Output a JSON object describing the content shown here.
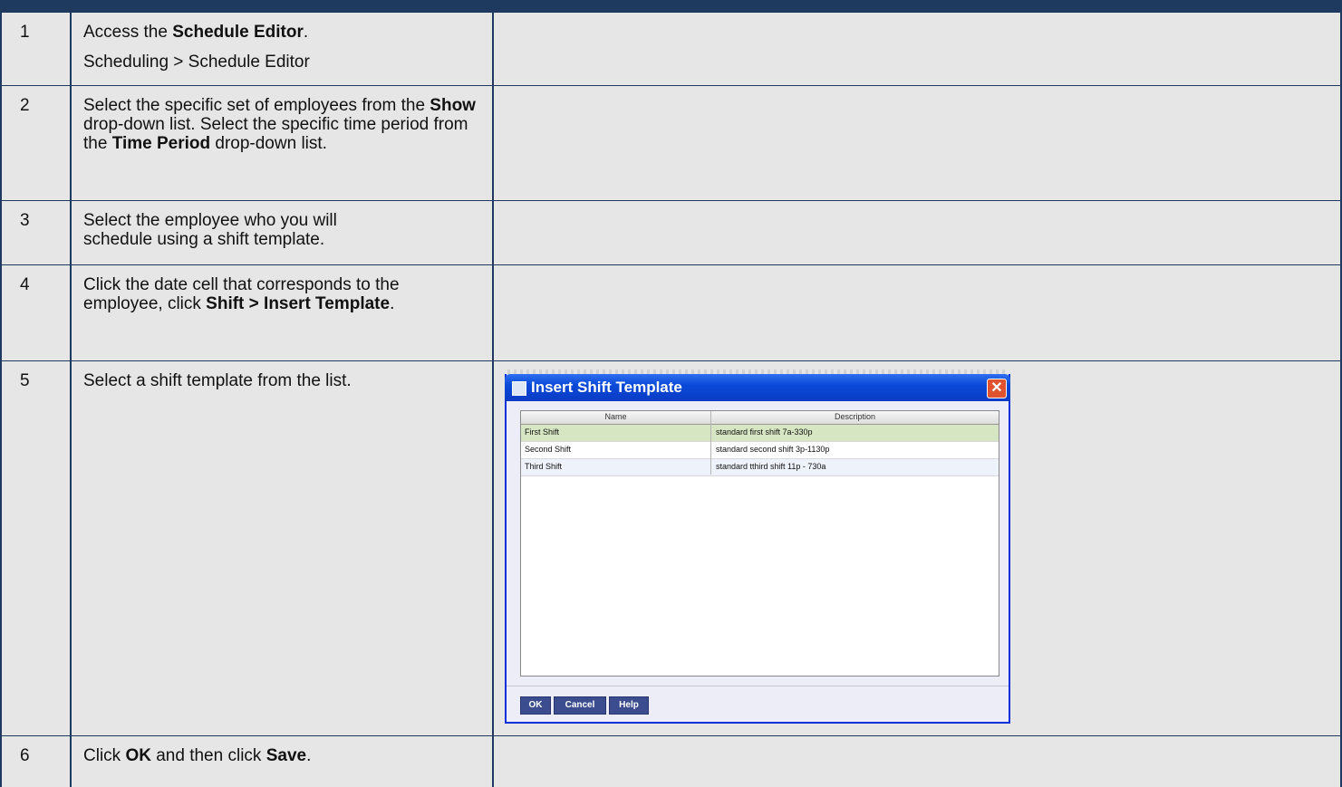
{
  "steps": [
    {
      "num": "1",
      "parts": [
        {
          "t": "Access the "
        },
        {
          "t": "Schedule Editor",
          "b": true
        },
        {
          "t": "."
        }
      ],
      "sub": "Scheduling > Schedule Editor"
    },
    {
      "num": "2",
      "parts": [
        {
          "t": "Select the specific set of employees from the "
        },
        {
          "t": "Show",
          "b": true
        },
        {
          "t": " drop-down list. Select the specific time period from the "
        },
        {
          "t": "Time Period",
          "b": true
        },
        {
          "t": " drop-down list."
        }
      ]
    },
    {
      "num": "3",
      "parts": [
        {
          "t": "Select the employee who you will schedule using a shift template."
        }
      ]
    },
    {
      "num": "4",
      "parts": [
        {
          "t": "Click the date cell that corresponds to the employee, click "
        },
        {
          "t": "Shift > Insert Template",
          "b": true
        },
        {
          "t": "."
        }
      ]
    },
    {
      "num": "5",
      "parts": [
        {
          "t": "Select a shift template from the list."
        }
      ]
    },
    {
      "num": "6",
      "parts": [
        {
          "t": "Click "
        },
        {
          "t": "OK",
          "b": true
        },
        {
          "t": " and then click "
        },
        {
          "t": "Save",
          "b": true
        },
        {
          "t": "."
        }
      ]
    }
  ],
  "dialog": {
    "title": "Insert Shift Template",
    "close": "✕",
    "columns": [
      "Name",
      "Description"
    ],
    "rows": [
      {
        "name": "First Shift",
        "description": "standard first shift 7a-330p"
      },
      {
        "name": "Second Shift",
        "description": "standard second shift 3p-1130p"
      },
      {
        "name": "Third Shift",
        "description": "standard tthird shift 11p - 730a"
      }
    ],
    "buttons": {
      "ok": "OK",
      "cancel": "Cancel",
      "help": "Help"
    }
  }
}
